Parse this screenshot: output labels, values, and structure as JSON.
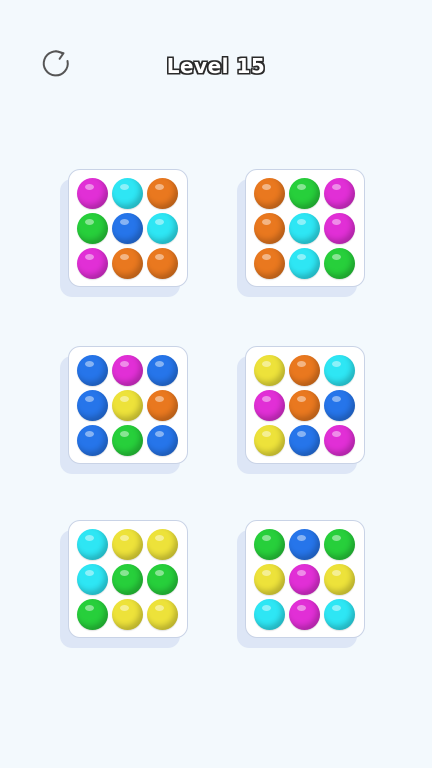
{
  "header": {
    "title": "Level 15",
    "restart_icon": "restart-icon"
  },
  "palette": {
    "magenta": "#e12fd6",
    "cyan": "#2ee6f4",
    "orange": "#e9781f",
    "green": "#27cf3b",
    "blue": "#2675ea",
    "yellow": "#ede23a"
  },
  "trays": [
    {
      "balls": [
        "magenta",
        "cyan",
        "orange",
        "green",
        "blue",
        "cyan",
        "magenta",
        "orange",
        "orange"
      ]
    },
    {
      "balls": [
        "orange",
        "green",
        "magenta",
        "orange",
        "cyan",
        "magenta",
        "orange",
        "cyan",
        "green"
      ]
    },
    {
      "balls": [
        "blue",
        "magenta",
        "blue",
        "blue",
        "yellow",
        "orange",
        "blue",
        "green",
        "blue"
      ]
    },
    {
      "balls": [
        "yellow",
        "orange",
        "cyan",
        "magenta",
        "orange",
        "blue",
        "yellow",
        "blue",
        "magenta"
      ]
    },
    {
      "balls": [
        "cyan",
        "yellow",
        "yellow",
        "cyan",
        "green",
        "green",
        "green",
        "yellow",
        "yellow"
      ]
    },
    {
      "balls": [
        "green",
        "blue",
        "green",
        "yellow",
        "magenta",
        "yellow",
        "cyan",
        "magenta",
        "cyan"
      ]
    }
  ]
}
